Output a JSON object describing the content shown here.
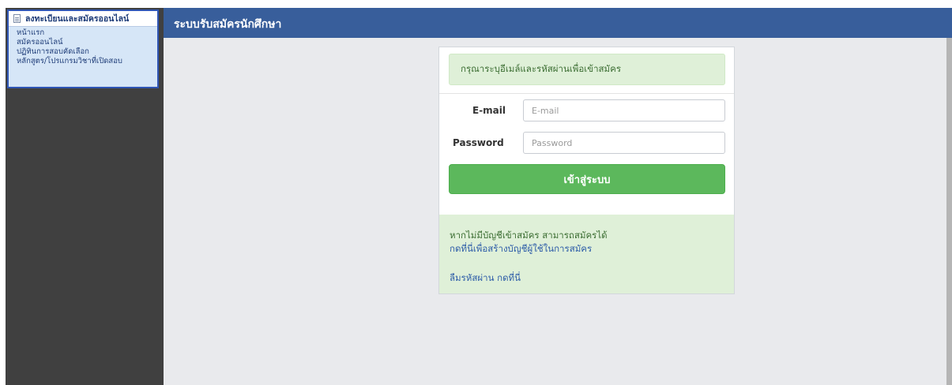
{
  "sidebar": {
    "header": "ลงทะเบียนและสมัครออนไลน์",
    "items": [
      {
        "label": "หน้าแรก"
      },
      {
        "label": "สมัครออนไลน์"
      },
      {
        "label": "ปฏิทินการสอบคัดเลือก"
      },
      {
        "label": "หลักสูตร/โปรแกรมวิชาที่เปิดสอบ"
      }
    ]
  },
  "header": {
    "title": "ระบบรับสมัครนักศึกษา"
  },
  "login": {
    "message": "กรุณาระบุอีเมล์และรหัสผ่านเพื่อเข้าสมัคร",
    "email_label": "E-mail",
    "email_placeholder": "E-mail",
    "password_label": "Password",
    "password_placeholder": "Password",
    "submit_label": "เข้าสู่ระบบ"
  },
  "info": {
    "no_account_text": "หากไม่มีบัญชีเข้าสมัคร สามารถสมัครได้",
    "create_account_link": "กดที่นี่เพื่อสร้างบัญชีผู้ใช้ในการสมัคร",
    "forgot_password_link": "ลืมรหัสผ่าน กดที่นี่"
  },
  "colors": {
    "topbar": "#385e9b",
    "sidebar": "#404040",
    "success_bg": "#dff0d8",
    "button": "#5cb85c",
    "link": "#2e5da8"
  }
}
